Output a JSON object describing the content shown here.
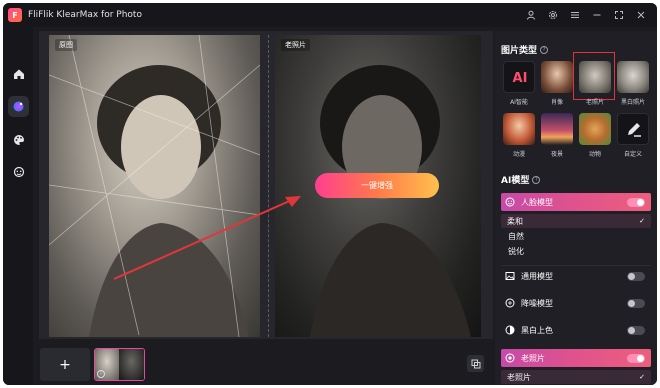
{
  "app": {
    "logo_letter": "F",
    "title": "FliFlik KlearMax for Photo",
    "titlebar_icons": [
      "user-icon",
      "settings-icon",
      "menu-icon",
      "minimize-icon",
      "maximize-icon",
      "close-icon"
    ]
  },
  "leftbar": {
    "items": [
      {
        "name": "home-icon",
        "active": false
      },
      {
        "name": "photo-enhance-icon",
        "active": true
      },
      {
        "name": "palette-icon",
        "active": false
      },
      {
        "name": "face-icon",
        "active": false
      }
    ]
  },
  "canvas": {
    "original_label": "原图",
    "result_label": "老照片",
    "enhance_button": "一键增强"
  },
  "bottombar": {
    "add_label": "+"
  },
  "panel": {
    "image_type_title": "图片类型",
    "image_types": [
      {
        "label": "AI智能",
        "icon": "AI",
        "selected": false
      },
      {
        "label": "肖像",
        "icon": "",
        "selected": false
      },
      {
        "label": "老照片",
        "icon": "",
        "selected": true
      },
      {
        "label": "黑白照片",
        "icon": "",
        "selected": false
      },
      {
        "label": "动漫",
        "icon": "",
        "selected": false
      },
      {
        "label": "夜景",
        "icon": "",
        "selected": false
      },
      {
        "label": "动物",
        "icon": "",
        "selected": false
      },
      {
        "label": "自定义",
        "icon": "",
        "selected": false
      }
    ],
    "ai_model_title": "AI模型",
    "face_model": {
      "label": "人脸模型",
      "enabled": true,
      "selected_option": "柔和",
      "options": [
        "自然",
        "锐化"
      ]
    },
    "general_model": {
      "label": "通用模型",
      "enabled": false
    },
    "denoise_model": {
      "label": "降噪模型",
      "enabled": false
    },
    "colorize": {
      "label": "黑白上色",
      "enabled": false
    },
    "old_photo": {
      "label": "老照片",
      "enabled": true,
      "selected_option": "老照片"
    }
  }
}
